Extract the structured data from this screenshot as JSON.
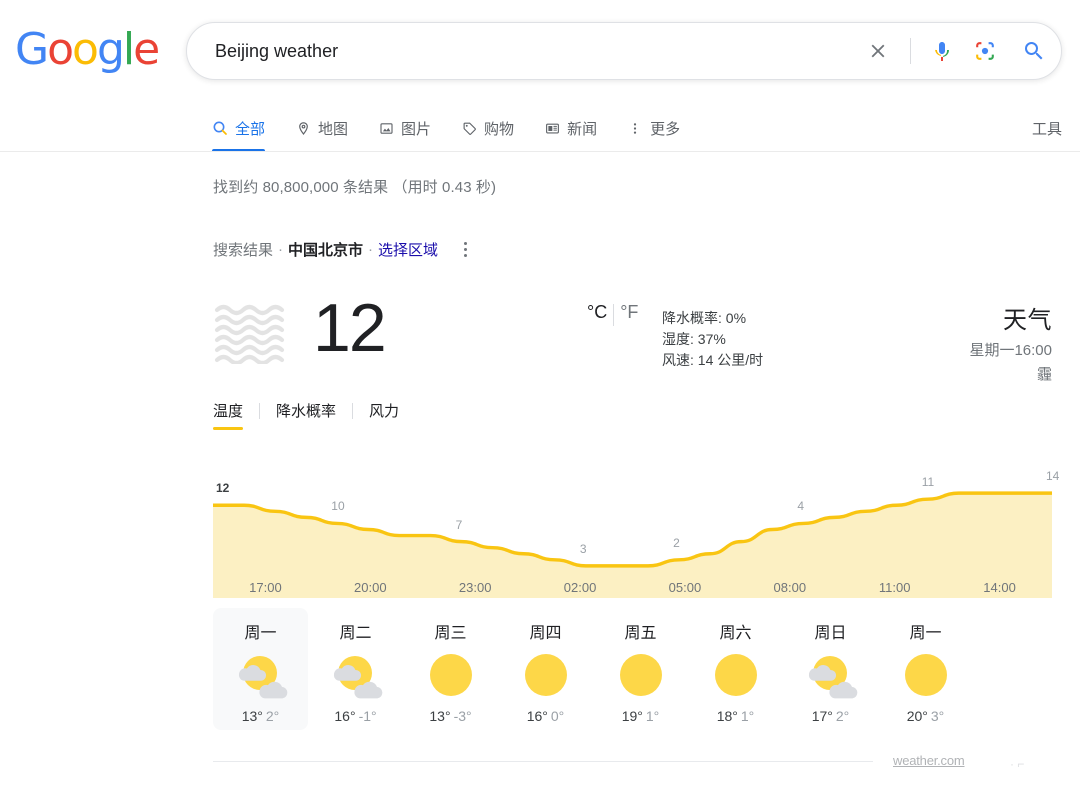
{
  "brand": {
    "logo_letters": [
      {
        "ch": "G",
        "color": "#4285F4"
      },
      {
        "ch": "o",
        "color": "#EA4335"
      },
      {
        "ch": "o",
        "color": "#FBBC05"
      },
      {
        "ch": "g",
        "color": "#4285F4"
      },
      {
        "ch": "l",
        "color": "#34A853"
      },
      {
        "ch": "e",
        "color": "#EA4335"
      }
    ]
  },
  "search": {
    "query": "Beijing weather",
    "placeholder": "",
    "clear_label": "×",
    "icons": [
      "clear-icon",
      "microphone-icon",
      "lens-camera-icon",
      "search-magnifier-icon"
    ]
  },
  "nav": {
    "items": [
      {
        "label": "全部",
        "icon": "search-icon",
        "active": true
      },
      {
        "label": "地图",
        "icon": "map-pin-icon",
        "active": false
      },
      {
        "label": "图片",
        "icon": "image-icon",
        "active": false
      },
      {
        "label": "购物",
        "icon": "tag-icon",
        "active": false
      },
      {
        "label": "新闻",
        "icon": "news-icon",
        "active": false
      },
      {
        "label": "更多",
        "icon": "more-dots-icon",
        "active": false
      }
    ],
    "tools_label": "工具"
  },
  "results": {
    "stats": "找到约 80,800,000 条结果 （用时 0.43 秒)",
    "location_prefix": "搜索结果",
    "location_name": "中国北京市",
    "location_link": "选择区域"
  },
  "weather": {
    "condition_icon": "haze-icon",
    "temperature": "12",
    "unit_celsius": "°C",
    "unit_fahrenheit": "°F",
    "details": [
      {
        "label": "降水概率:",
        "value": "0%"
      },
      {
        "label": "湿度:",
        "value": "37%"
      },
      {
        "label": "风速:",
        "value": "14 公里/时"
      }
    ],
    "title": "天气",
    "time": "星期一16:00",
    "condition": "霾",
    "tabs": [
      {
        "label": "温度",
        "active": true
      },
      {
        "label": "降水概率",
        "active": false
      },
      {
        "label": "风力",
        "active": false
      }
    ],
    "colors": {
      "line": "#F9C512",
      "fill": "#FCF0C3",
      "accent_blue": "#1a73e8",
      "selected_card": "#f8f9fa"
    },
    "attribution": "weather.com"
  },
  "chart_data": {
    "type": "area",
    "title": "温度",
    "xlabel": "",
    "ylabel": "°C",
    "x": [
      "17:00",
      "20:00",
      "23:00",
      "02:00",
      "05:00",
      "08:00",
      "11:00",
      "14:00"
    ],
    "point_labels": [
      "12",
      "10",
      "7",
      "3",
      "2",
      "4",
      "11",
      "14"
    ],
    "values": [
      12,
      10,
      7,
      3,
      2,
      4,
      11,
      14
    ],
    "series": [
      {
        "name": "温度",
        "values": [
          12,
          12,
          11,
          10,
          9,
          8,
          7,
          7,
          6,
          5,
          4,
          3,
          2,
          2,
          2,
          3,
          4,
          6,
          8,
          9,
          10,
          11,
          12,
          13,
          14,
          14,
          14,
          14
        ]
      }
    ],
    "ylim": [
      0,
      16
    ],
    "grid": false,
    "legend": "none"
  },
  "forecast": [
    {
      "day": "周一",
      "icon": "partly-cloudy-icon",
      "high": "13°",
      "low": "2°",
      "selected": true
    },
    {
      "day": "周二",
      "icon": "partly-cloudy-icon",
      "high": "16°",
      "low": "-1°",
      "selected": false
    },
    {
      "day": "周三",
      "icon": "sunny-icon",
      "high": "13°",
      "low": "-3°",
      "selected": false
    },
    {
      "day": "周四",
      "icon": "sunny-icon",
      "high": "16°",
      "low": "0°",
      "selected": false
    },
    {
      "day": "周五",
      "icon": "sunny-icon",
      "high": "19°",
      "low": "1°",
      "selected": false
    },
    {
      "day": "周六",
      "icon": "sunny-icon",
      "high": "18°",
      "low": "1°",
      "selected": false
    },
    {
      "day": "周日",
      "icon": "partly-cloudy-icon",
      "high": "17°",
      "low": "2°",
      "selected": false
    },
    {
      "day": "周一",
      "icon": "sunny-icon",
      "high": "20°",
      "low": "3°",
      "selected": false
    }
  ]
}
